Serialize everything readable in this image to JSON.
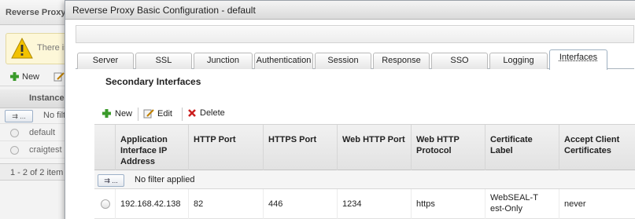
{
  "background": {
    "title": "Reverse Proxy",
    "warning_text": "There is",
    "toolbar_new": "New",
    "column_instance": "Instance",
    "filter_button": "⇉ ...",
    "filter_text": "No filt",
    "rows": [
      "default",
      "craigtest"
    ],
    "footer": "1 - 2 of 2 item"
  },
  "dialog": {
    "title": "Reverse Proxy Basic Configuration - default",
    "tabs": [
      {
        "label": "Server",
        "active": false
      },
      {
        "label": "SSL",
        "active": false
      },
      {
        "label": "Junction",
        "active": false
      },
      {
        "label": "Authentication",
        "active": false
      },
      {
        "label": "Session",
        "active": false
      },
      {
        "label": "Response",
        "active": false
      },
      {
        "label": "SSO",
        "active": false
      },
      {
        "label": "Logging",
        "active": false
      },
      {
        "label": "Interfaces",
        "active": true
      }
    ],
    "section_title": "Secondary Interfaces",
    "toolbar": {
      "new": "New",
      "edit": "Edit",
      "delete": "Delete"
    },
    "columns": [
      "Application Interface IP Address",
      "HTTP Port",
      "HTTPS Port",
      "Web HTTP Port",
      "Web HTTP Protocol",
      "Certificate Label",
      "Accept Client Certificates"
    ],
    "filter_button": "⇉ ...",
    "filter_text": "No filter applied",
    "rows": [
      {
        "ip": "192.168.42.138",
        "http_port": "82",
        "https_port": "446",
        "web_http_port": "1234",
        "web_http_protocol": "https",
        "certificate_label": "WebSEAL-Test-Only",
        "accept_client_certificates": "never"
      }
    ]
  },
  "colors": {
    "add_green": "#3a9a2a",
    "delete_red": "#cc2020",
    "warning_yellow": "#f2c200"
  }
}
